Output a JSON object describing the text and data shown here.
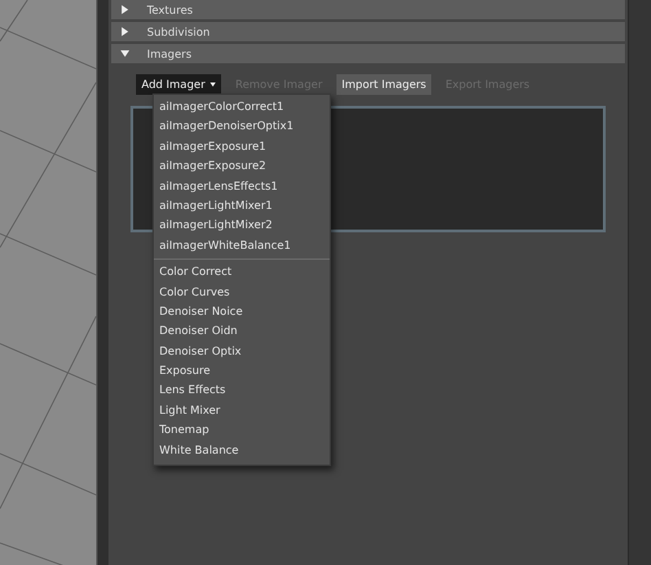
{
  "sections": [
    {
      "title": "Textures",
      "expanded": false
    },
    {
      "title": "Subdivision",
      "expanded": false
    },
    {
      "title": "Imagers",
      "expanded": true
    }
  ],
  "toolbar": [
    {
      "label": "Add Imager",
      "kind": "dropdown",
      "disabled": false
    },
    {
      "label": "Remove Imager",
      "kind": "button",
      "disabled": true
    },
    {
      "label": "Import Imagers",
      "kind": "button",
      "disabled": false
    },
    {
      "label": "Export Imagers",
      "kind": "button",
      "disabled": true
    }
  ],
  "menu": {
    "groups": [
      [
        "aiImagerColorCorrect1",
        "aiImagerDenoiserOptix1",
        "aiImagerExposure1",
        "aiImagerExposure2",
        "aiImagerLensEffects1",
        "aiImagerLightMixer1",
        "aiImagerLightMixer2",
        "aiImagerWhiteBalance1"
      ],
      [
        "Color Correct",
        "Color Curves",
        "Denoiser Noice",
        "Denoiser Oidn",
        "Denoiser Optix",
        "Exposure",
        "Lens Effects",
        "Light Mixer",
        "Tonemap",
        "White Balance"
      ]
    ]
  }
}
